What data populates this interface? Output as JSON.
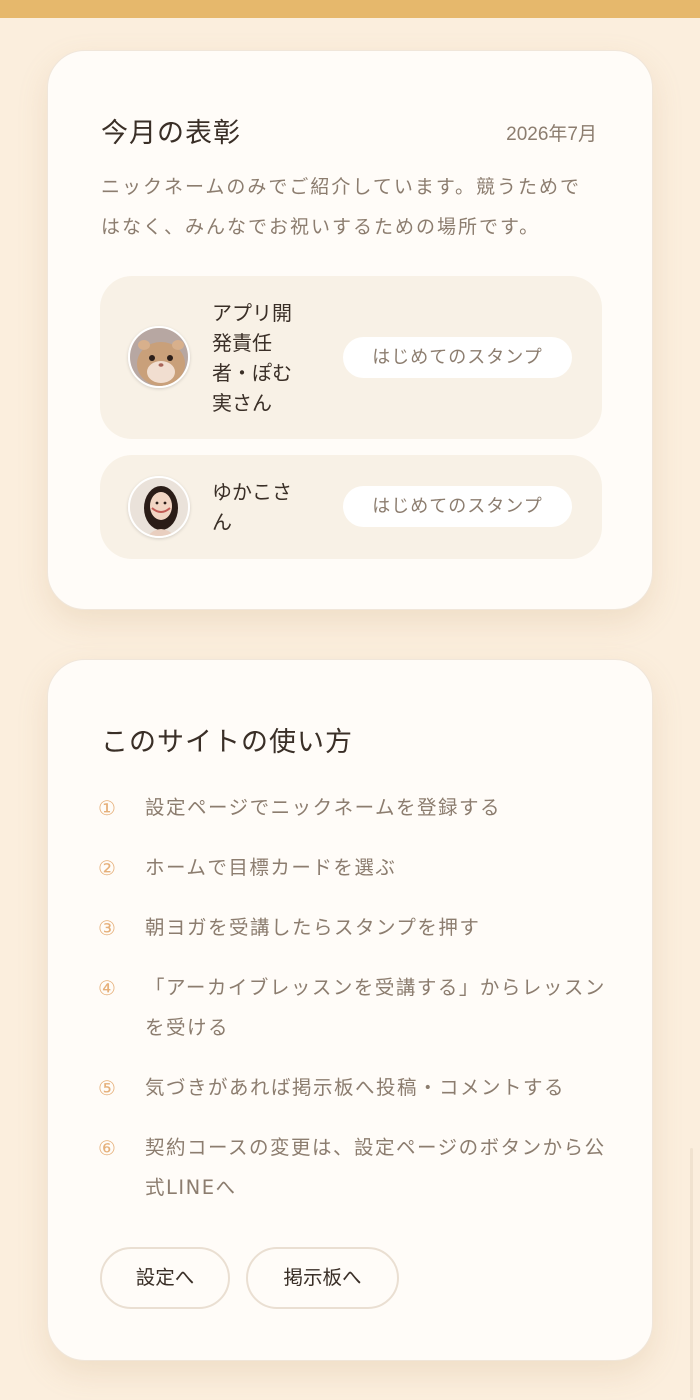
{
  "awards": {
    "title": "今月の表彰",
    "month": "2026年7月",
    "intro": "ニックネームのみでご紹介しています。競うためではなく、みんなでお祝いするための場所です。",
    "winners": [
      {
        "name": "アプリ開発責任者・ぽむ実さん",
        "badge": "はじめてのスタンプ",
        "avatar": "hamster-avatar"
      },
      {
        "name": "ゆかこさん",
        "badge": "はじめてのスタンプ",
        "avatar": "woman-avatar"
      }
    ]
  },
  "howto": {
    "title": "このサイトの使い方",
    "steps": [
      {
        "num": "①",
        "text": "設定ページでニックネームを登録する"
      },
      {
        "num": "②",
        "text": "ホームで目標カードを選ぶ"
      },
      {
        "num": "③",
        "text": "朝ヨガを受講したらスタンプを押す"
      },
      {
        "num": "④",
        "text": "「アーカイブレッスンを受講する」からレッスンを受ける"
      },
      {
        "num": "⑤",
        "text": "気づきがあれば掲示板へ投稿・コメントする"
      },
      {
        "num": "⑥",
        "text": "契約コースの変更は、設定ページのボタンから公式LINEへ"
      }
    ],
    "settings_button": "設定へ",
    "board_button": "掲示板へ"
  },
  "colors": {
    "accent": "#e6b86c",
    "background": "#fbeedd",
    "card": "#fffcf8",
    "step_number": "#e6b07a",
    "muted_text": "#8c7d6f"
  }
}
